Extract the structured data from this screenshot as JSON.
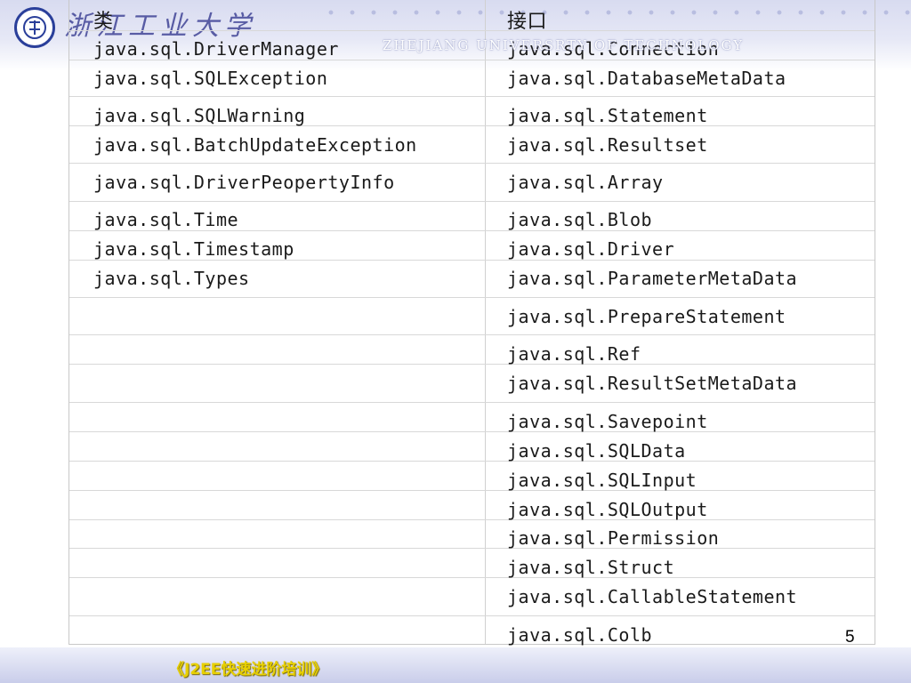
{
  "header": {
    "logo_text": "浙江工业大学",
    "university_en": "ZHEJIANG UNIVERSRTY OF TECHNOLOGY"
  },
  "table": {
    "headers": [
      "类",
      "接口"
    ],
    "rows": [
      [
        "java.sql.DriverManager",
        "java.sql.Connection"
      ],
      [
        "java.sql.SQLException",
        "java.sql.DatabaseMetaData"
      ],
      [
        "java.sql.SQLWarning",
        "java.sql.Statement"
      ],
      [
        "java.sql.BatchUpdateException",
        "java.sql.Resultset"
      ],
      [
        "java.sql.DriverPeopertyInfo",
        "java.sql.Array"
      ],
      [
        "java.sql.Time",
        "java.sql.Blob"
      ],
      [
        "java.sql.Timestamp",
        "java.sql.Driver"
      ],
      [
        "java.sql.Types",
        "java.sql.ParameterMetaData"
      ],
      [
        "",
        "java.sql.PrepareStatement"
      ],
      [
        "",
        "java.sql.Ref"
      ],
      [
        "",
        "java.sql.ResultSetMetaData"
      ],
      [
        "",
        "java.sql.Savepoint"
      ],
      [
        "",
        "java.sql.SQLData"
      ],
      [
        "",
        "java.sql.SQLInput"
      ],
      [
        "",
        "java.sql.SQLOutput"
      ],
      [
        "",
        "java.sql.Permission"
      ],
      [
        "",
        "java.sql.Struct"
      ],
      [
        "",
        "java.sql.CallableStatement"
      ],
      [
        "",
        "java.sql.Colb"
      ]
    ]
  },
  "page_number": "5",
  "footer": {
    "course_title": "《J2EE快速进阶培训》"
  },
  "colors": {
    "header_band": "#d8dbf0",
    "footer_text": "#e8d000",
    "logo_blue": "#2a3f9a"
  }
}
